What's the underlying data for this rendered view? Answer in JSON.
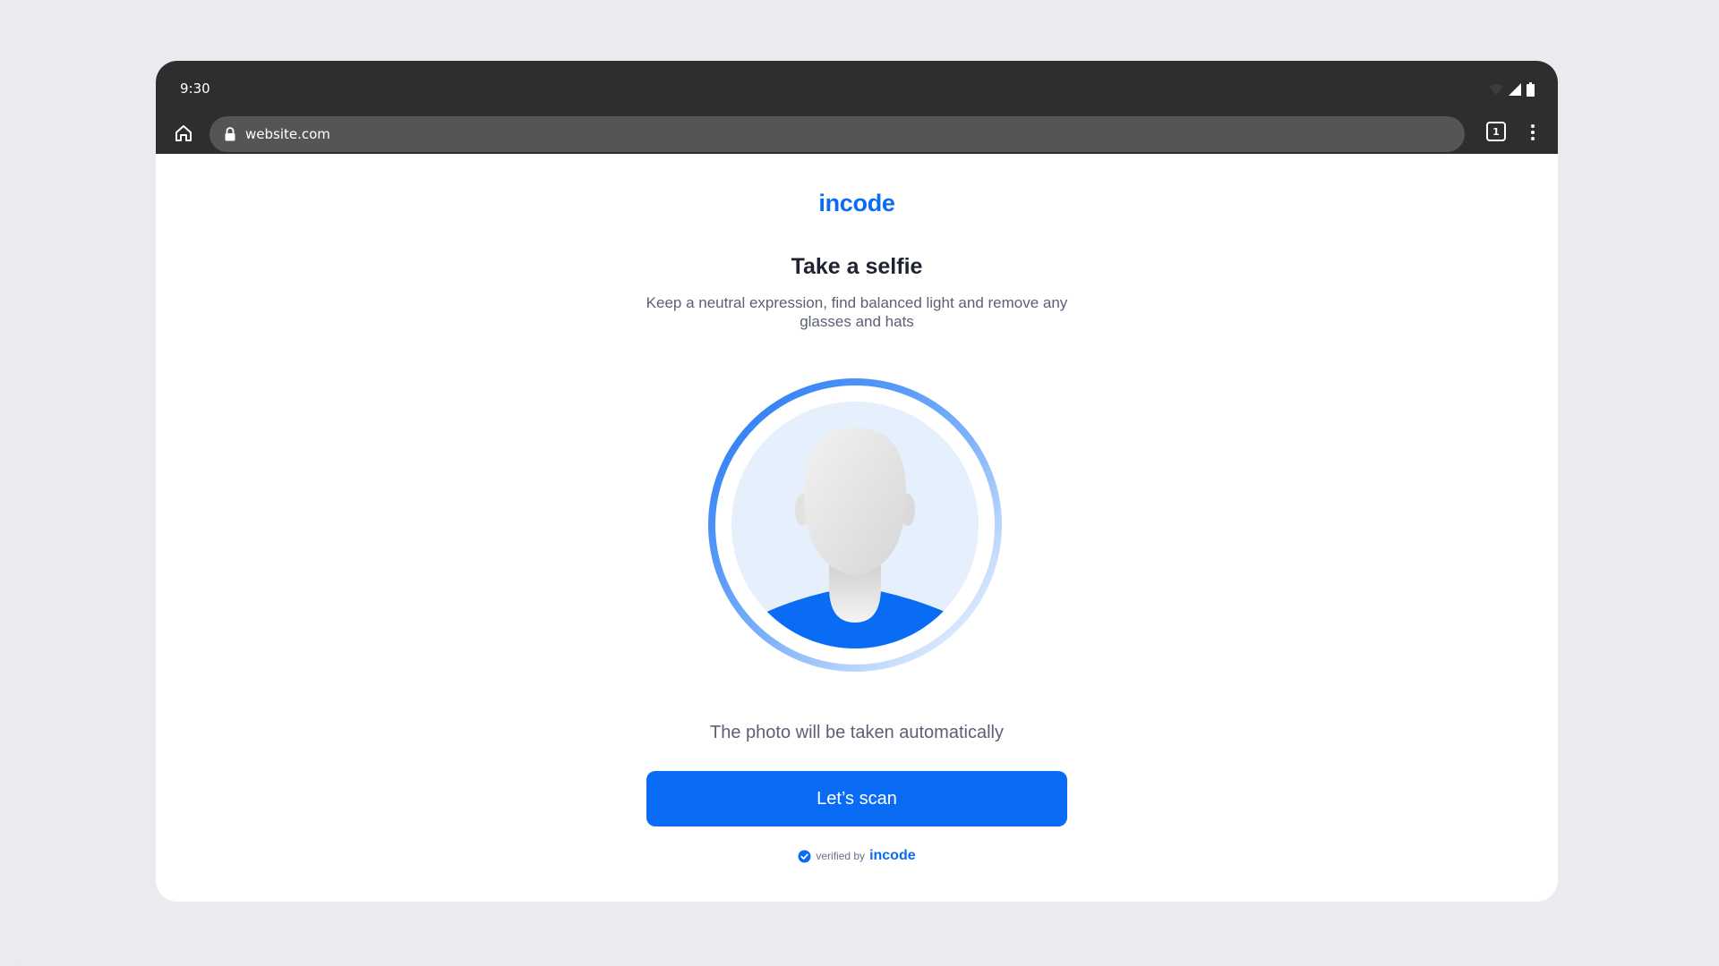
{
  "status_bar": {
    "time": "9:30"
  },
  "browser": {
    "url": "website.com",
    "tab_count": "1"
  },
  "page": {
    "logo": "incode",
    "title": "Take a selfie",
    "subtitle": "Keep a neutral expression, find balanced light and remove any glasses and hats",
    "auto_text": "The photo will be taken automatically",
    "scan_button_label": "Let’s scan",
    "verified_label": "verified by",
    "verified_logo": "incode"
  },
  "colors": {
    "accent": "#0a6cf5",
    "chrome": "#2e2e2e",
    "urlbar": "#555555",
    "illustration_bg": "#e6f0fd"
  },
  "icons": [
    "home-icon",
    "lock-icon",
    "tabs-icon",
    "more-vert-icon",
    "wifi-icon",
    "signal-icon",
    "battery-icon",
    "verified-check-icon"
  ]
}
